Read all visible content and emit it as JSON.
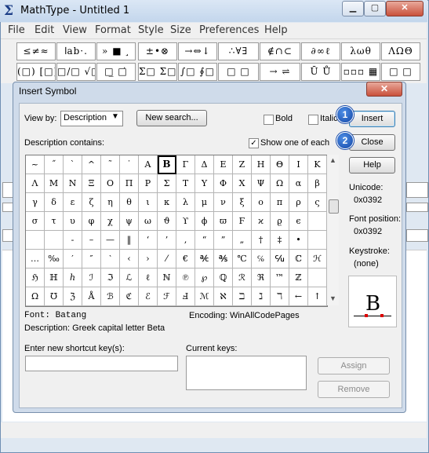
{
  "window": {
    "title": "MathType - Untitled 1",
    "min": "▁",
    "max": "▢",
    "close": "✕"
  },
  "menu": [
    "File",
    "Edit",
    "View",
    "Format",
    "Style",
    "Size",
    "Preferences",
    "Help"
  ],
  "palette_row1": [
    "≤≠≈",
    "اab·.",
    "» ■ ¸",
    "±•⊗",
    "→⇔↓",
    "∴∀∃",
    "∉∩⊂",
    "∂∞ℓ",
    "λωθ",
    "ΛΩΘ"
  ],
  "palette_row2": [
    "(□) [□]",
    "□/□ √□",
    "□̲ □̇",
    "Σ□ Σ□",
    "∫□ ∮□",
    "□ □",
    "→ ⇌",
    "Ū Ů",
    "▫▫▫ ▦",
    "□ □"
  ],
  "dialog": {
    "title": "Insert Symbol",
    "close": "✕",
    "view_by_label": "View by:",
    "view_by_value": "Description",
    "new_search": "New search...",
    "bold": "Bold",
    "italic": "Italic",
    "insert": "Insert",
    "close_button": "Close",
    "help": "Help",
    "desc_contains": "Description contains:",
    "show_one_of_each": "Show one of each",
    "unicode_label": "Unicode:",
    "unicode_value": "0x0392",
    "font_position_label": "Font position:",
    "font_position_value": "0x0392",
    "keystroke_label": "Keystroke:",
    "keystroke_value": "(none)",
    "font_line": "Font: Batang",
    "encoding_line": "Encoding:   WinAllCodePages",
    "description_line": "Description: Greek capital letter Beta",
    "shortcut_label": "Enter new shortcut key(s):",
    "current_keys_label": "Current keys:",
    "assign": "Assign",
    "remove": "Remove",
    "preview_char": "B",
    "badge1": "1",
    "badge2": "2"
  },
  "symbols": [
    [
      "~",
      "˝",
      "`",
      "^",
      "˜",
      "˙",
      "Α",
      "Β",
      "Γ",
      "Δ",
      "Ε",
      "Ζ",
      "Η",
      "Θ",
      "Ι",
      "Κ"
    ],
    [
      "Λ",
      "Μ",
      "Ν",
      "Ξ",
      "Ο",
      "Π",
      "Ρ",
      "Σ",
      "Τ",
      "Υ",
      "Φ",
      "Χ",
      "Ψ",
      "Ω",
      "α",
      "β"
    ],
    [
      "γ",
      "δ",
      "ε",
      "ζ",
      "η",
      "θ",
      "ι",
      "κ",
      "λ",
      "μ",
      "ν",
      "ξ",
      "ο",
      "π",
      "ρ",
      "ς"
    ],
    [
      "σ",
      "τ",
      "υ",
      "φ",
      "χ",
      "ψ",
      "ω",
      "ϑ",
      "ϒ",
      "ϕ",
      "ϖ",
      "Ϝ",
      "ϰ",
      "ϱ",
      "ϵ",
      ""
    ],
    [
      "",
      "",
      "-",
      "–",
      "—",
      "‖",
      "‘",
      "’",
      "‚",
      "“",
      "”",
      "„",
      "†",
      "‡",
      "•",
      ""
    ],
    [
      "…",
      "‰",
      "′",
      "″",
      "‵",
      "‹",
      "›",
      "⁄",
      "€",
      "℀",
      "℁",
      "℃",
      "℅",
      "℆",
      "ℂ",
      "ℋ"
    ],
    [
      "ℌ",
      "ℍ",
      "ℎ",
      "ℐ",
      "ℑ",
      "ℒ",
      "ℓ",
      "ℕ",
      "℗",
      "℘",
      "ℚ",
      "ℛ",
      "ℜ",
      "™",
      "ℤ",
      ""
    ],
    [
      "Ω",
      "℧",
      "ℨ",
      "Å",
      "ℬ",
      "ℭ",
      "ℰ",
      "ℱ",
      "Ⅎ",
      "ℳ",
      "ℵ",
      "ℶ",
      "ℷ",
      "ℸ",
      "←",
      "↑"
    ]
  ],
  "selected_cell": [
    0,
    7
  ],
  "colors": {
    "badge": "#1346a6",
    "close_red": "#c9513c"
  }
}
